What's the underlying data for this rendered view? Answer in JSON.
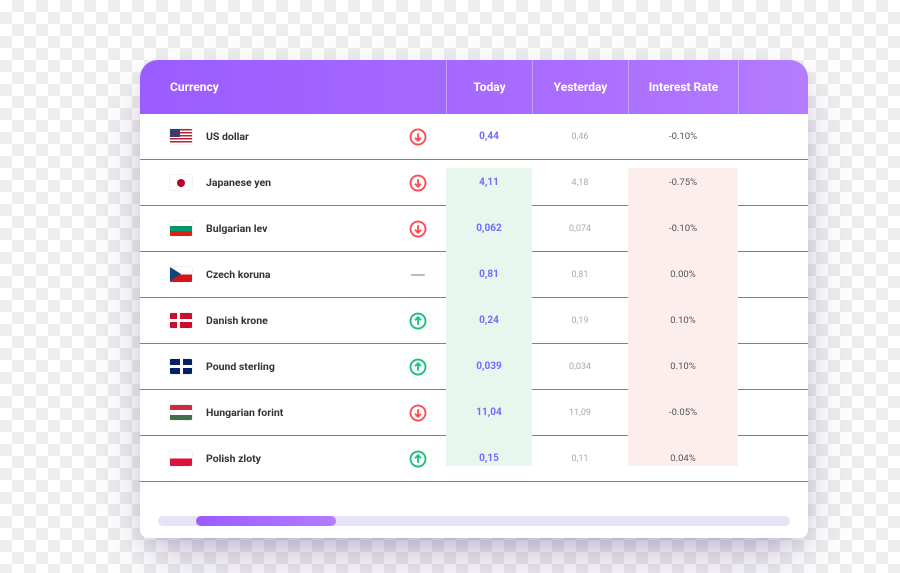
{
  "colors": {
    "accent": "#9a5cff",
    "up": "#17c27c",
    "down": "#ff4b55",
    "today_bg": "#e8f7ee",
    "rate_bg": "#fdeeee"
  },
  "headers": {
    "currency": "Currency",
    "today": "Today",
    "yesterday": "Yesterday",
    "interest_rate": "Interest Rate"
  },
  "rows": [
    {
      "flag": "us",
      "name": "US dollar",
      "trend": "down",
      "today": "0,44",
      "yesterday": "0,46",
      "rate": "-0.10%"
    },
    {
      "flag": "jp",
      "name": "Japanese yen",
      "trend": "down",
      "today": "4,11",
      "yesterday": "4,18",
      "rate": "-0.75%"
    },
    {
      "flag": "bg",
      "name": "Bulgarian lev",
      "trend": "down",
      "today": "0,062",
      "yesterday": "0,074",
      "rate": "-0.10%"
    },
    {
      "flag": "cz",
      "name": "Czech koruna",
      "trend": "flat",
      "today": "0,81",
      "yesterday": "0,81",
      "rate": "0.00%"
    },
    {
      "flag": "dk",
      "name": "Danish krone",
      "trend": "up",
      "today": "0,24",
      "yesterday": "0,19",
      "rate": "0.10%"
    },
    {
      "flag": "gb",
      "name": "Pound sterling",
      "trend": "up",
      "today": "0,039",
      "yesterday": "0,034",
      "rate": "0.10%"
    },
    {
      "flag": "hu",
      "name": "Hungarian forint",
      "trend": "down",
      "today": "11,04",
      "yesterday": "11,09",
      "rate": "-0.05%"
    },
    {
      "flag": "pl",
      "name": "Polish zloty",
      "trend": "up",
      "today": "0,15",
      "yesterday": "0,11",
      "rate": "0.04%"
    }
  ]
}
